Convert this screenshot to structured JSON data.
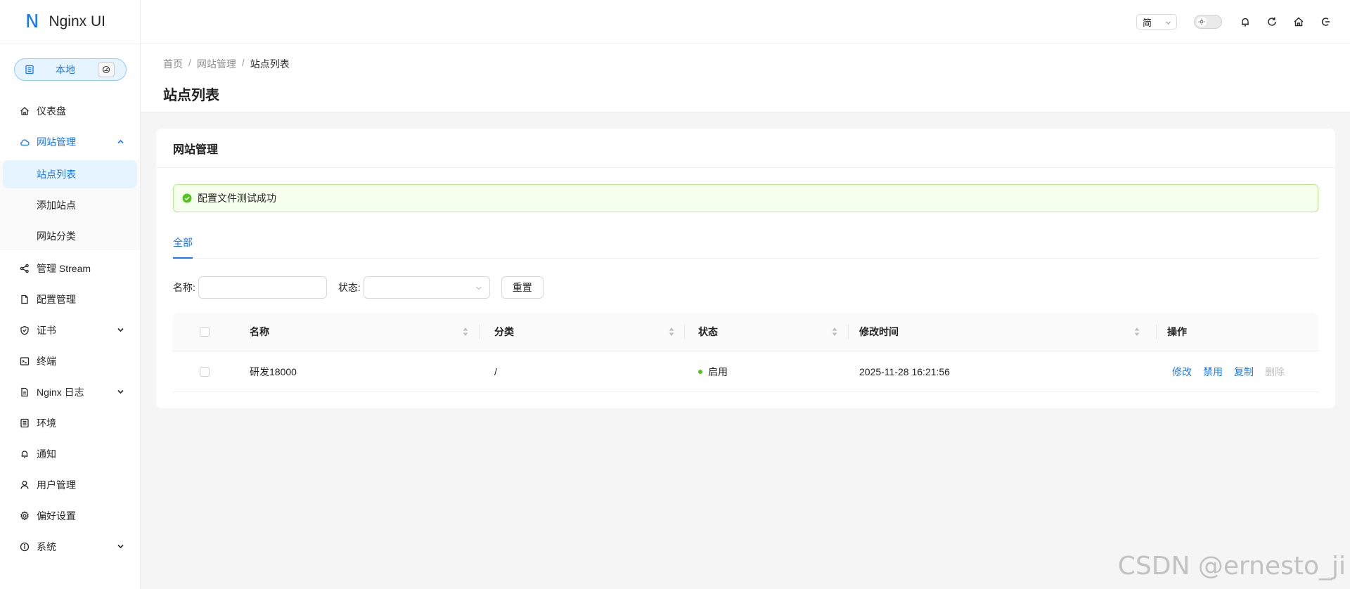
{
  "app": {
    "logo_mark": "N",
    "logo_text": "Nginx UI",
    "node_label": "本地",
    "brand_color": "#1677ff"
  },
  "header": {
    "language": "简",
    "icons": [
      "sun-icon",
      "bell-icon",
      "refresh-icon",
      "home-icon",
      "logout-icon"
    ]
  },
  "sidebar": {
    "items": [
      {
        "label": "仪表盘",
        "icon": "home-icon"
      },
      {
        "label": "网站管理",
        "icon": "cloud-icon",
        "expanded": true,
        "children": [
          {
            "label": "站点列表",
            "active": true
          },
          {
            "label": "添加站点"
          },
          {
            "label": "网站分类"
          }
        ]
      },
      {
        "label": "管理 Stream",
        "icon": "share-icon"
      },
      {
        "label": "配置管理",
        "icon": "file-icon"
      },
      {
        "label": "证书",
        "icon": "shield-icon",
        "has_children": true
      },
      {
        "label": "终端",
        "icon": "terminal-icon"
      },
      {
        "label": "Nginx 日志",
        "icon": "file-text-icon",
        "has_children": true
      },
      {
        "label": "环境",
        "icon": "database-icon"
      },
      {
        "label": "通知",
        "icon": "bell-icon"
      },
      {
        "label": "用户管理",
        "icon": "user-icon"
      },
      {
        "label": "偏好设置",
        "icon": "gear-icon"
      },
      {
        "label": "系统",
        "icon": "info-icon",
        "has_children": true
      }
    ]
  },
  "page": {
    "breadcrumb": [
      "首页",
      "网站管理",
      "站点列表"
    ],
    "title": "站点列表"
  },
  "card": {
    "title": "网站管理",
    "alert": "配置文件测试成功",
    "tabs": [
      {
        "label": "全部",
        "active": true
      }
    ]
  },
  "filters": {
    "name_label": "名称:",
    "name_value": "",
    "status_label": "状态:",
    "status_value": "",
    "reset_label": "重置"
  },
  "table": {
    "columns": [
      "名称",
      "分类",
      "状态",
      "修改时间",
      "操作"
    ],
    "rows": [
      {
        "name": "研发18000",
        "category": "/",
        "status": "启用",
        "modified": "2025-11-28 16:21:56",
        "actions": [
          "修改",
          "禁用",
          "复制",
          "删除"
        ]
      }
    ]
  },
  "watermark": "CSDN @ernesto_ji"
}
